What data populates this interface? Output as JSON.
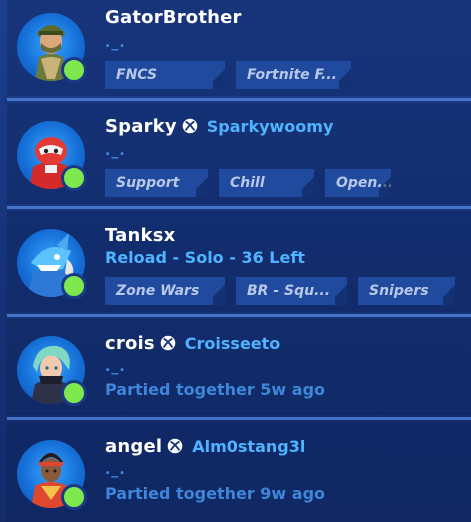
{
  "friends": [
    {
      "username": "GatorBrother",
      "platform_icon": "",
      "platform_name": "",
      "status": "._.",
      "status_type": "emote",
      "tags": [
        "FNCS",
        "Fortnite F..."
      ],
      "avatar": "gator-skin-avatar",
      "online": true
    },
    {
      "username": "Sparky",
      "platform_icon": "xbox-icon",
      "platform_name": "Sparkywoomy",
      "status": "._.",
      "status_type": "emote",
      "tags": [
        "Support",
        "Chill",
        "Open..."
      ],
      "avatar": "robot-skin-avatar",
      "online": true
    },
    {
      "username": "Tanksx",
      "platform_icon": "",
      "platform_name": "",
      "status": "Reload - Solo - 36 Left",
      "status_type": "playing",
      "tags": [
        "Zone Wars",
        "BR - Squ...",
        "Snipers"
      ],
      "avatar": "shark-skin-avatar",
      "online": true
    },
    {
      "username": "crois",
      "platform_icon": "xbox-icon",
      "platform_name": "Croisseeto",
      "status": "._.",
      "status_type": "emote",
      "party": "Partied together 5w ago",
      "tags": [],
      "avatar": "teal-hair-skin-avatar",
      "online": true
    },
    {
      "username": "angel",
      "platform_icon": "xbox-icon",
      "platform_name": "Alm0stang3l",
      "status": "._.",
      "status_type": "emote",
      "party": "Partied together 9w ago",
      "tags": [],
      "avatar": "red-outfit-skin-avatar",
      "online": true
    }
  ],
  "colors": {
    "background": "#16347a",
    "online": "#7ee84f",
    "platform_name": "#4fb3ff",
    "party_text": "#3f86d8",
    "tag_bg": "#1f4a9e",
    "tag_text": "#b9c8e8",
    "separator": "#4f7fd3"
  }
}
